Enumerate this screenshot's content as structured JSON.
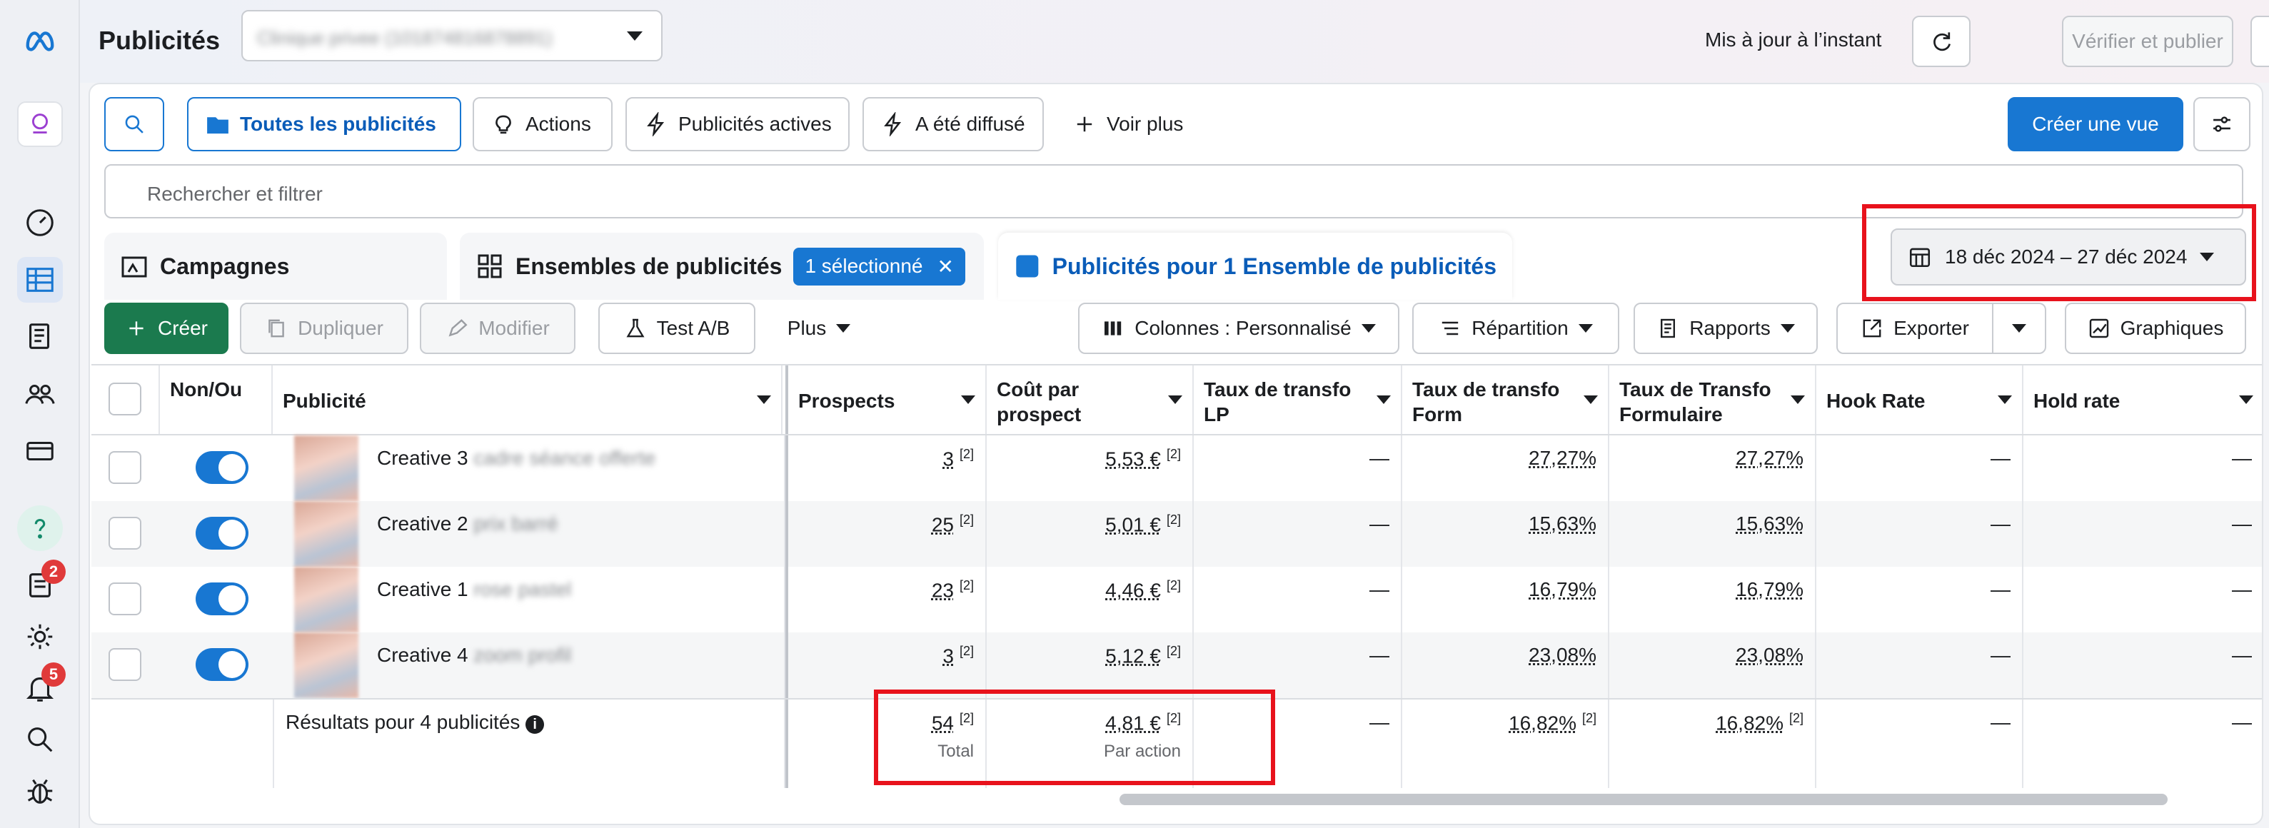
{
  "app": {
    "title": "Publicités",
    "account_blurred": "Clinique privee (101874816878891)"
  },
  "header": {
    "updated": "Mis à jour à l’instant",
    "verify_publish": "Vérifier et publier"
  },
  "filters": {
    "all_ads": "Toutes les publicités",
    "actions": "Actions",
    "active_ads": "Publicités actives",
    "delivered": "A été diffusé",
    "see_more": "Voir plus",
    "create_view": "Créer une vue",
    "search_placeholder": "Rechercher et filtrer"
  },
  "tabs": {
    "campaigns": "Campagnes",
    "adsets": "Ensembles de publicités",
    "selected": "1 sélectionné",
    "ads": "Publicités pour 1 Ensemble de publicités"
  },
  "date_range": "18 déc 2024 – 27 déc 2024",
  "toolbar": {
    "create": "Créer",
    "duplicate": "Dupliquer",
    "edit": "Modifier",
    "ab_test": "Test A/B",
    "more": "Plus",
    "columns": "Colonnes : Personnalisé",
    "breakdown": "Répartition",
    "reports": "Rapports",
    "export": "Exporter",
    "charts": "Graphiques"
  },
  "table": {
    "headers": {
      "onoff": "Non/Ou",
      "ad": "Publicité",
      "prospects": "Prospects",
      "cost": "Coût par prospect",
      "lp": "Taux de transfo LP",
      "form": "Taux de transfo Form",
      "formulaire": "Taux de Transfo Formulaire",
      "hook": "Hook Rate",
      "hold": "Hold rate"
    },
    "rows": [
      {
        "name": "Creative 3",
        "hidden": "cadre séance offerte",
        "prospects": "3",
        "cost": "5,53 €",
        "lp": "—",
        "form": "27,27%",
        "formulaire": "27,27%",
        "hook": "—",
        "hold": "—"
      },
      {
        "name": "Creative 2",
        "hidden": "prix barré",
        "prospects": "25",
        "cost": "5,01 €",
        "lp": "—",
        "form": "15,63%",
        "formulaire": "15,63%",
        "hook": "—",
        "hold": "—"
      },
      {
        "name": "Creative 1",
        "hidden": "rose pastel",
        "prospects": "23",
        "cost": "4,46 €",
        "lp": "—",
        "form": "16,79%",
        "formulaire": "16,79%",
        "hook": "—",
        "hold": "—"
      },
      {
        "name": "Creative 4",
        "hidden": "zoom profil",
        "prospects": "3",
        "cost": "5,12 €",
        "lp": "—",
        "form": "23,08%",
        "formulaire": "23,08%",
        "hook": "—",
        "hold": "—"
      }
    ],
    "footnote": "[2]",
    "totals": {
      "label": "Résultats pour 4 publicités",
      "prospects": "54",
      "prospects_sub": "Total",
      "cost": "4,81 €",
      "cost_sub": "Par action",
      "lp": "—",
      "form": "16,82%",
      "formulaire": "16,82%",
      "hook": "—",
      "hold": "—"
    }
  },
  "badges": {
    "notifications": "2",
    "alerts": "5"
  },
  "colors": {
    "accent": "#1877d2",
    "create_green": "#1b7a4e",
    "highlight_red": "#e8121c"
  }
}
